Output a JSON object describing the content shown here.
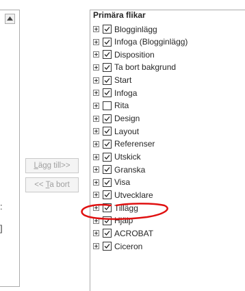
{
  "buttons": {
    "add": {
      "prefix": "",
      "accel": "L",
      "rest": "ägg till>>"
    },
    "remove": {
      "prefix": "<< ",
      "accel": "T",
      "rest": "a bort"
    }
  },
  "brackets": [
    ":",
    "]"
  ],
  "tabs_list": {
    "header": "Primära flikar",
    "items": [
      {
        "label": "Blogginlägg",
        "checked": true
      },
      {
        "label": "Infoga (Blogginlägg)",
        "checked": true
      },
      {
        "label": "Disposition",
        "checked": true
      },
      {
        "label": "Ta bort bakgrund",
        "checked": true
      },
      {
        "label": "Start",
        "checked": true
      },
      {
        "label": "Infoga",
        "checked": true
      },
      {
        "label": "Rita",
        "checked": false
      },
      {
        "label": "Design",
        "checked": true
      },
      {
        "label": "Layout",
        "checked": true
      },
      {
        "label": "Referenser",
        "checked": true
      },
      {
        "label": "Utskick",
        "checked": true
      },
      {
        "label": "Granska",
        "checked": true
      },
      {
        "label": "Visa",
        "checked": true
      },
      {
        "label": "Utvecklare",
        "checked": true
      },
      {
        "label": "Tillägg",
        "checked": true
      },
      {
        "label": "Hjälp",
        "checked": true
      },
      {
        "label": "ACROBAT",
        "checked": true
      },
      {
        "label": "Ciceron",
        "checked": true
      }
    ]
  },
  "colors": {
    "annotation": "#e01010",
    "border": "#ababab",
    "disabled_text": "#a0a0a0"
  }
}
